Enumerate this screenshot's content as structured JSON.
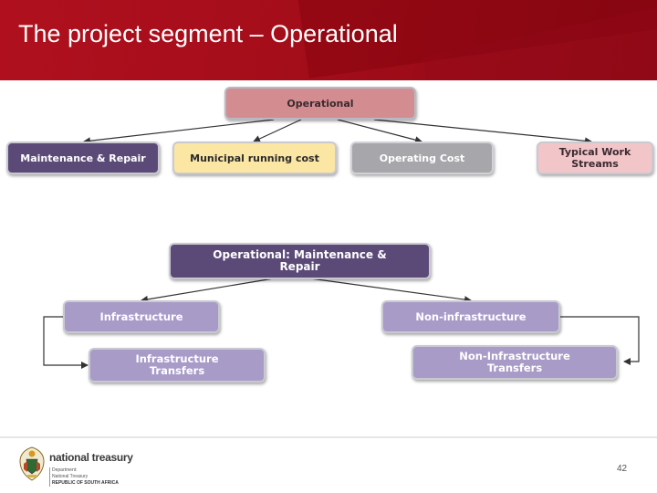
{
  "slide": {
    "title": "The project segment – Operational",
    "page_number": "42"
  },
  "diagram": {
    "top": {
      "root": "Operational",
      "children": [
        "Maintenance & Repair",
        "Municipal running cost",
        "Operating Cost",
        "Typical Work Streams"
      ]
    },
    "bottom": {
      "root": "Operational: Maintenance & Repair",
      "left_child": "Infrastructure",
      "left_transfer": "Infrastructure Transfers",
      "right_child": "Non-infrastructure",
      "right_transfer": "Non-Infrastructure Transfers"
    }
  },
  "footer": {
    "brand_name": "national treasury",
    "department_line1": "Department:",
    "department_line2": "National Treasury",
    "country": "REPUBLIC OF SOUTH AFRICA"
  },
  "colors": {
    "header_red": "#a40d1a",
    "root_pink": "#d38c8f",
    "purple_dark": "#5b4a78",
    "yellow": "#fbe6a4",
    "grey": "#a6a6ab",
    "pink_light": "#f2c6c9",
    "lavender": "#a89bc8"
  }
}
